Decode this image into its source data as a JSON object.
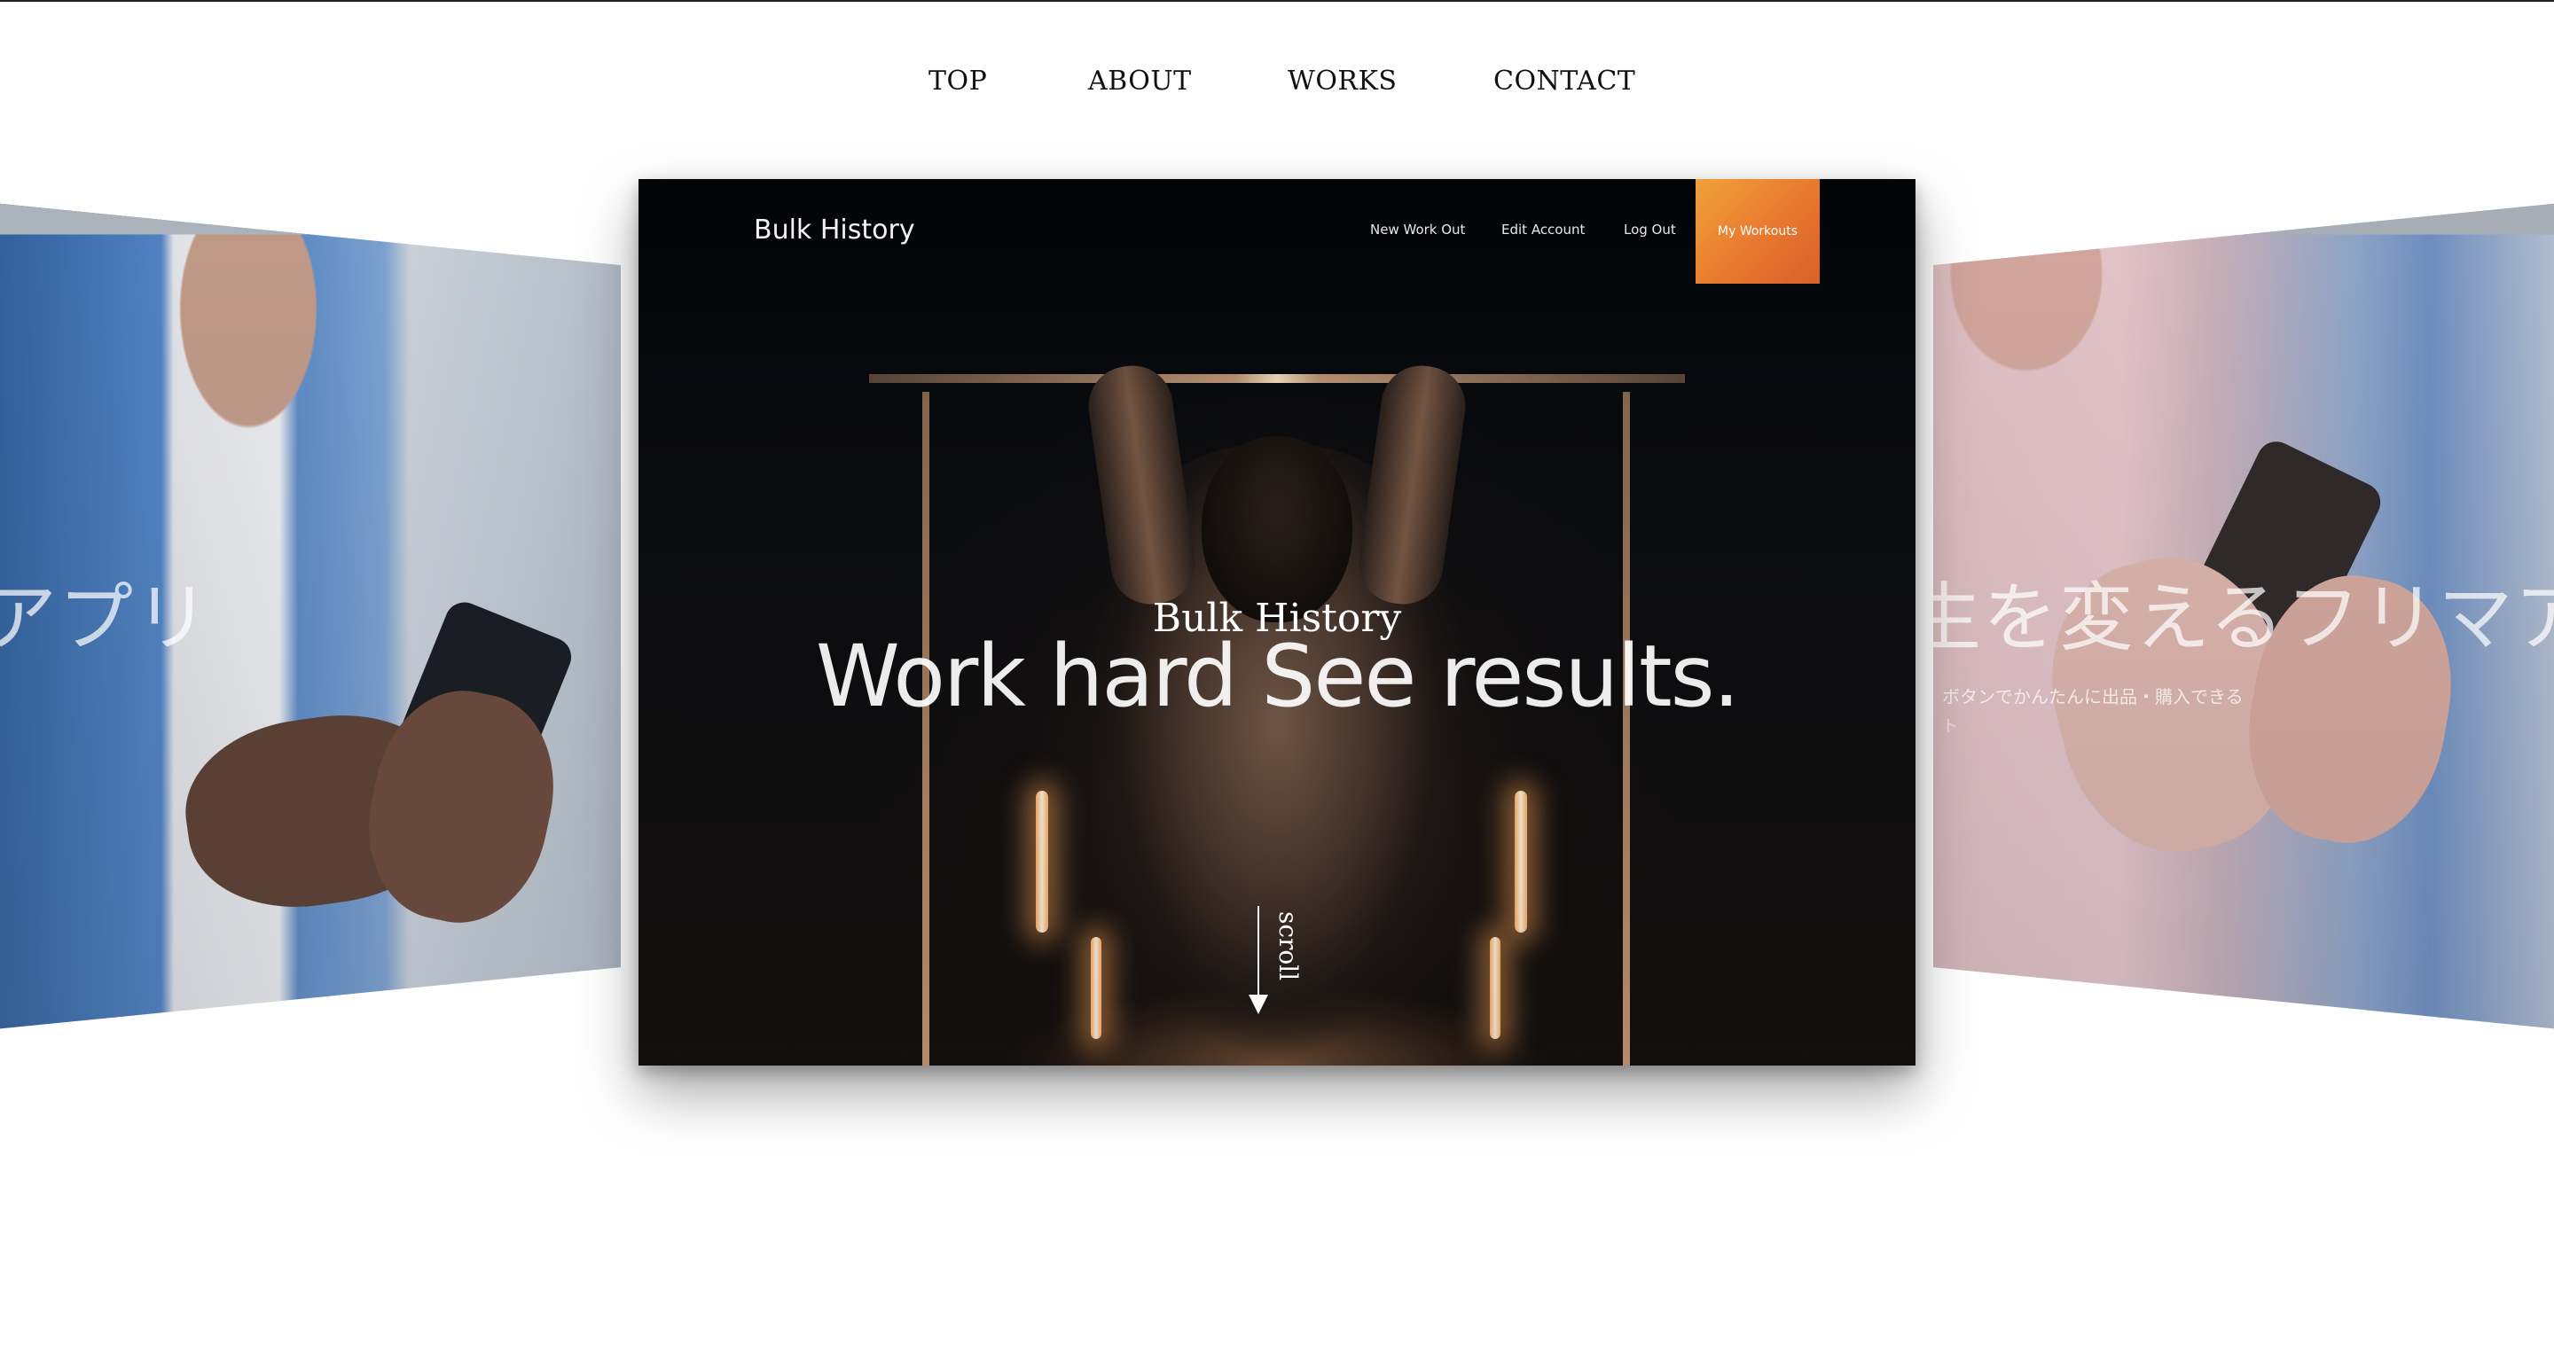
{
  "main_nav": {
    "items": [
      {
        "label": "TOP"
      },
      {
        "label": "ABOUT"
      },
      {
        "label": "WORKS"
      },
      {
        "label": "CONTACT"
      }
    ]
  },
  "cards": {
    "left": {
      "heading": "アプリ"
    },
    "right": {
      "heading": "生を変えるフリマアプリ",
      "subtitle": "ボタンでかんたんに出品・購入できる",
      "subtitle2": "ト"
    },
    "center": {
      "app_title": "Bulk History",
      "nav": {
        "new_workout": "New Work Out",
        "edit_account": "Edit Account",
        "log_out": "Log Out",
        "my_workouts": "My Workouts"
      },
      "hero_kicker": "Bulk History",
      "hero_headline": "Work hard See results.",
      "scroll_label": "scroll"
    }
  },
  "colors": {
    "accent_button": "#e8782e",
    "page_background": "#ffffff",
    "hero_background": "#04070c"
  }
}
